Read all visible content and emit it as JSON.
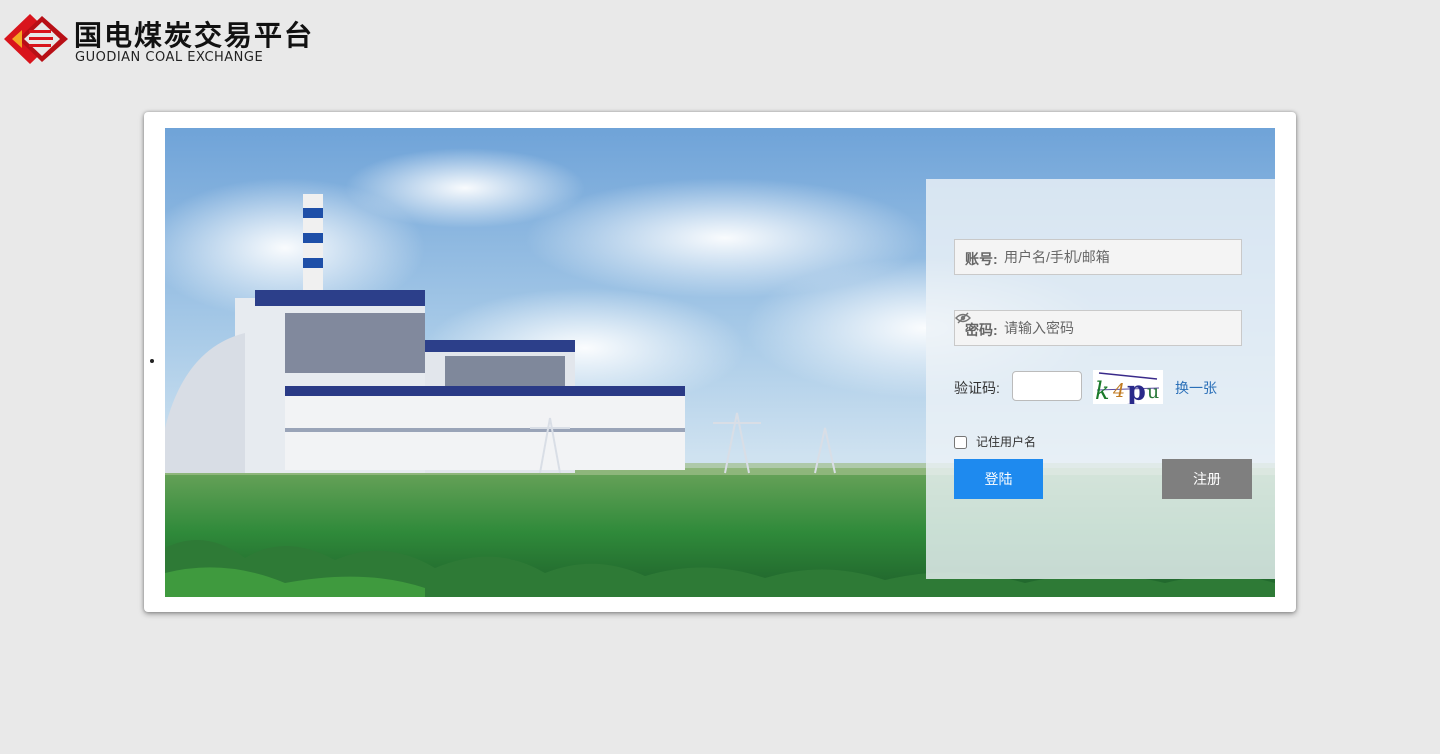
{
  "header": {
    "logo_cn": "国电煤炭交易平台",
    "logo_en": "GUODIAN  COAL  EXCHANGE"
  },
  "login": {
    "account_label": "账号:",
    "account_placeholder": "用户名/手机/邮箱",
    "password_label": "密码:",
    "password_placeholder": "请输入密码",
    "captcha_label": "验证码:",
    "captcha_value": "",
    "captcha_text": "k4pu",
    "refresh_label": "换一张",
    "remember_label": "记住用户名",
    "remember_checked": false,
    "login_button": "登陆",
    "register_button": "注册"
  },
  "colors": {
    "page_bg": "#e9e9e9",
    "login_button": "#1e8aef",
    "register_button": "#7f7f7f",
    "link": "#2a6fb8",
    "logo_red": "#d9141c"
  },
  "icons": {
    "eye": "eye-slash-icon",
    "logo": "guodian-logo-icon"
  }
}
